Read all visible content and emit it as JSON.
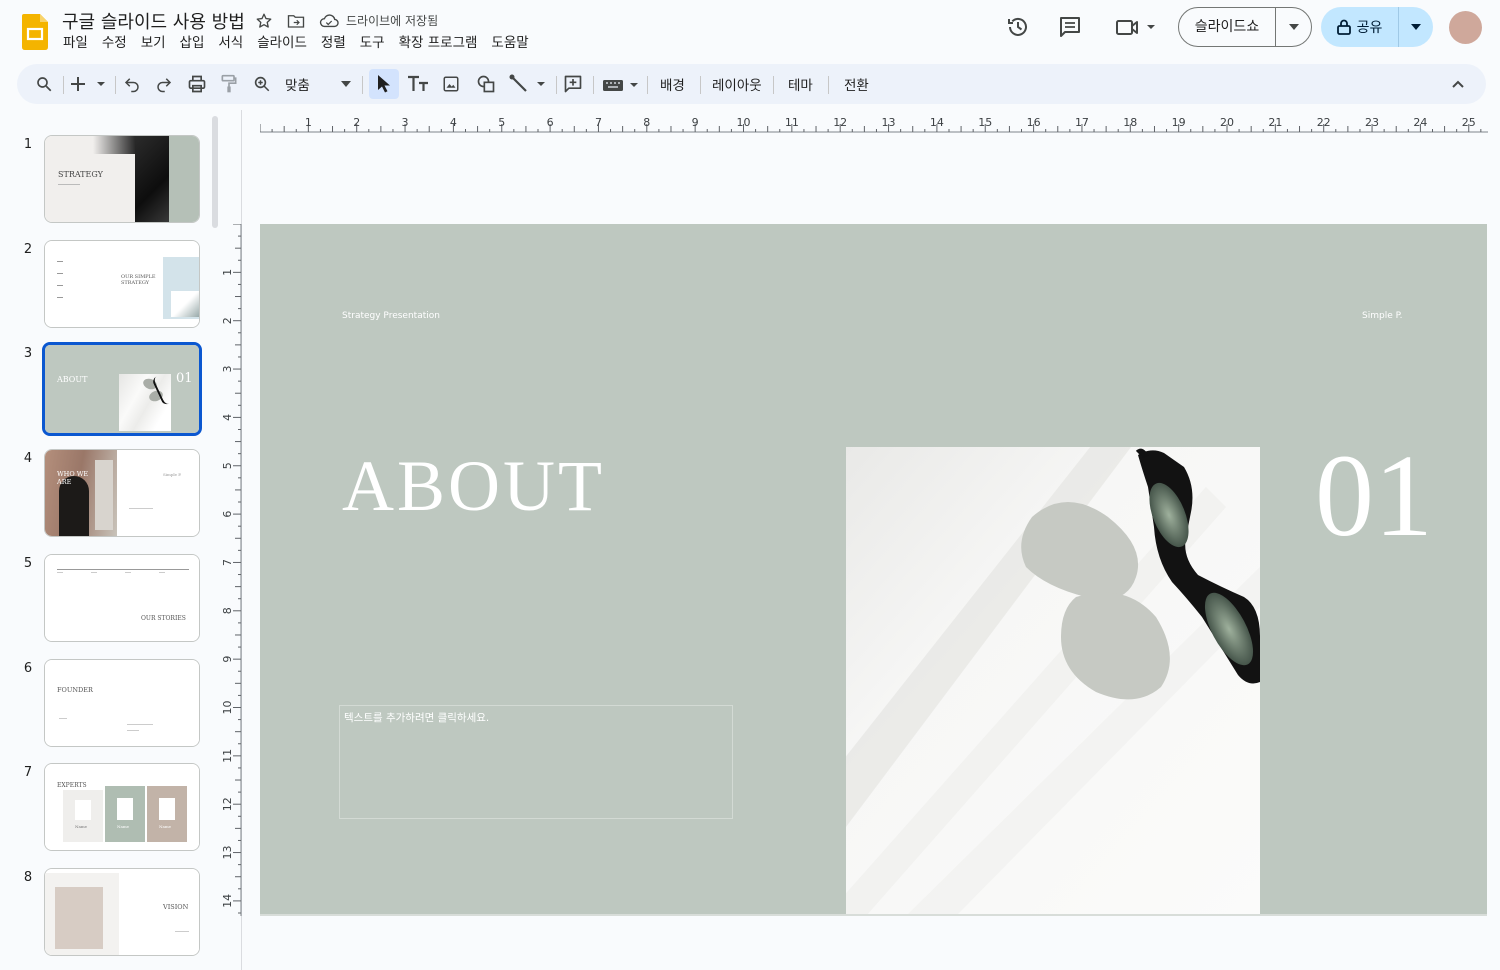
{
  "app": {
    "doc_title": "구글 슬라이드 사용 방법",
    "save_status": "드라이브에 저장됨",
    "logo_icon": "slides-logo-icon",
    "star_icon": "star-icon",
    "move_icon": "folder-move-icon",
    "cloud_icon": "cloud-saved-icon"
  },
  "menu": [
    "파일",
    "수정",
    "보기",
    "삽입",
    "서식",
    "슬라이드",
    "정렬",
    "도구",
    "확장 프로그램",
    "도움말"
  ],
  "header": {
    "slideshow_label": "슬라이드쇼",
    "share_label": "공유",
    "icons": [
      "history-icon",
      "comments-icon",
      "meet-icon"
    ]
  },
  "toolbar": {
    "zoom_label": "맞춤",
    "background_label": "배경",
    "layout_label": "레이아웃",
    "theme_label": "테마",
    "transition_label": "전환",
    "icons": [
      "search-icon",
      "new-slide-icon",
      "undo-icon",
      "redo-icon",
      "print-icon",
      "paint-format-icon",
      "zoom-icon",
      "select-icon",
      "text-box-icon",
      "image-icon",
      "shape-icon",
      "line-icon",
      "comment-add-icon",
      "input-tools-icon",
      "collapse-icon"
    ]
  },
  "filmstrip": {
    "slides": [
      {
        "num": "1",
        "text": "STRATEGY"
      },
      {
        "num": "2",
        "text": "OUR SIMPLE STRATEGY"
      },
      {
        "num": "3",
        "text": "ABOUT",
        "extra": "01"
      },
      {
        "num": "4",
        "text": "WHO WE ARE",
        "extra": "Simple P."
      },
      {
        "num": "5",
        "text": "OUR STORIES"
      },
      {
        "num": "6",
        "text": "FOUNDER"
      },
      {
        "num": "7",
        "text": "EXPERTS",
        "names": [
          "Name",
          "Name",
          "Name"
        ]
      },
      {
        "num": "8",
        "text": "VISION"
      }
    ]
  },
  "rulers": {
    "horizontal": [
      "1",
      "2",
      "3",
      "4",
      "5",
      "6",
      "7",
      "8",
      "9",
      "10",
      "11",
      "12",
      "13",
      "14",
      "15",
      "16",
      "17",
      "18",
      "19",
      "20",
      "21",
      "22",
      "23",
      "24",
      "25"
    ],
    "vertical": [
      "1",
      "2",
      "3",
      "4",
      "5",
      "6",
      "7",
      "8",
      "9",
      "10",
      "11",
      "12",
      "13",
      "14"
    ]
  },
  "slide": {
    "top_left": "Strategy Presentation",
    "top_right": "Simple P.",
    "title": "ABOUT",
    "number": "01",
    "placeholder": "텍스트를 추가하려면 클릭하세요.",
    "background_color": "#bec8c0"
  }
}
